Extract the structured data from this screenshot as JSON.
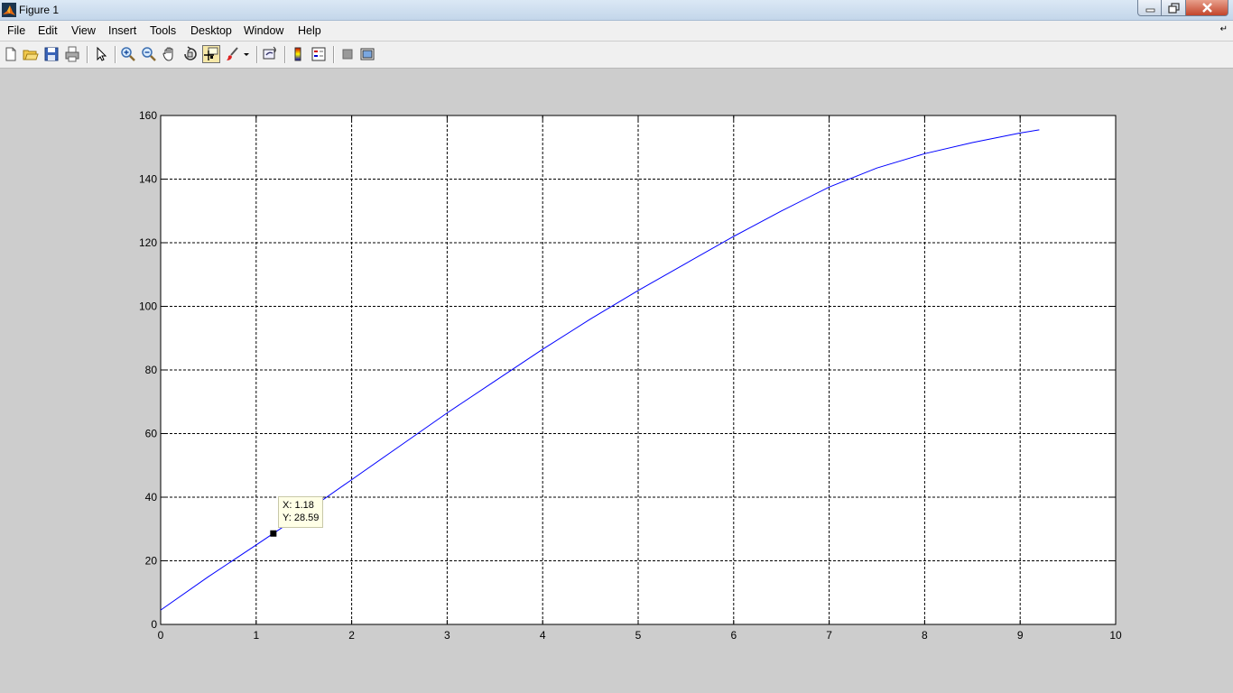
{
  "window": {
    "title": "Figure 1"
  },
  "menu": [
    "File",
    "Edit",
    "View",
    "Insert",
    "Tools",
    "Desktop",
    "Window",
    "Help"
  ],
  "toolbar": {
    "buttons": [
      "new-figure-icon",
      "open-file-icon",
      "save-icon",
      "print-icon",
      "edit-plot-arrow-icon",
      "zoom-in-icon",
      "zoom-out-icon",
      "pan-hand-icon",
      "rotate-3d-icon",
      "data-cursor-icon",
      "brush-icon",
      "link-plot-icon",
      "colorbar-icon",
      "legend-icon",
      "hide-plot-tools-icon",
      "show-plot-tools-icon"
    ],
    "pressed": "data-cursor-icon"
  },
  "datatip": {
    "x_text": "X: 1.18",
    "y_text": "Y: 28.59"
  },
  "colors": {
    "line": "#0000ff",
    "background": "#cdcdcd",
    "axes": "#ffffff"
  },
  "chart_data": {
    "type": "line",
    "title": "",
    "xlabel": "",
    "ylabel": "",
    "xlim": [
      0,
      10
    ],
    "ylim": [
      0,
      160
    ],
    "xticks": [
      0,
      1,
      2,
      3,
      4,
      5,
      6,
      7,
      8,
      9,
      10
    ],
    "yticks": [
      0,
      20,
      40,
      60,
      80,
      100,
      120,
      140,
      160
    ],
    "grid": true,
    "series": [
      {
        "x": [
          0,
          0.5,
          1,
          1.18,
          1.5,
          2,
          2.5,
          3,
          3.5,
          4,
          4.5,
          5,
          5.5,
          6,
          6.5,
          7,
          7.5,
          8,
          8.5,
          9,
          9.2
        ],
        "y": [
          4.5,
          15,
          25,
          28.59,
          35,
          45.5,
          56,
          66.5,
          76.5,
          86.5,
          96,
          105,
          113.5,
          122,
          130,
          137.5,
          143.5,
          148,
          151.5,
          154.5,
          155.5
        ]
      }
    ],
    "marker": {
      "x": 1.18,
      "y": 28.59
    }
  }
}
